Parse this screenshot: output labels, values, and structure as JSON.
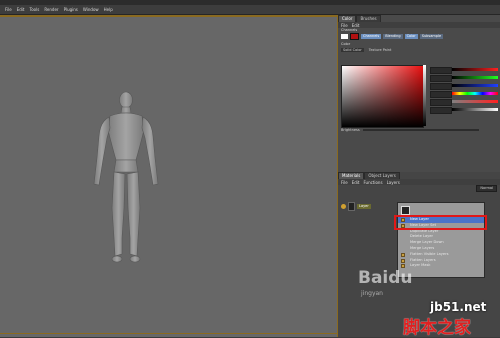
{
  "menubar": {
    "items": [
      "File",
      "Edit",
      "Tools",
      "Render",
      "Plugins",
      "Window",
      "Help"
    ]
  },
  "top_panel": {
    "tabs": [
      "Color",
      "Brushes"
    ],
    "subbar": [
      "File",
      "Edit"
    ],
    "channels_label": "Channels",
    "channel_chips": [
      "Channels",
      "Blending",
      "Color",
      "Subsample"
    ],
    "color_label": "Color",
    "mode_options": [
      "Solid Color",
      "Texture Paint"
    ],
    "brightness_label": "Brightness"
  },
  "layers_panel": {
    "tabs": [
      "Materials",
      "Object Layers"
    ],
    "subbar": [
      "File",
      "Edit",
      "Functions",
      "Layers"
    ],
    "mode_value": "Normal",
    "layer_name": "Layer"
  },
  "context_menu": {
    "items": [
      "New Layer",
      "New Layer Set",
      "Duplicate Layer",
      "Delete Layer",
      "Merge Layer Down",
      "Merge Layers",
      "Flatten Visible Layers",
      "Flatten Layers",
      "Layer Mask"
    ],
    "highlighted_index": 0
  },
  "watermark": {
    "brand": "Baidu",
    "site": "jb51.net",
    "cn": "脚本之家",
    "small": "jingyan"
  },
  "colors": {
    "accent_border": "#8a6a20",
    "highlight_red": "#e01818",
    "menu_highlight": "#4a73c8"
  }
}
